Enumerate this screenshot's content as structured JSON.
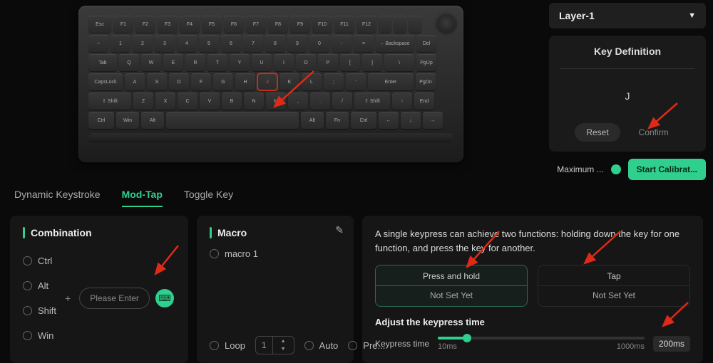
{
  "layer": {
    "label": "Layer-1"
  },
  "keydef": {
    "title": "Key Definition",
    "key": "J",
    "reset": "Reset",
    "confirm": "Confirm"
  },
  "calib": {
    "max_label": "Maximum ...",
    "start": "Start Calibrat..."
  },
  "tabs": {
    "dynamic": "Dynamic Keystroke",
    "modtap": "Mod-Tap",
    "toggle": "Toggle Key"
  },
  "combination": {
    "title": "Combination",
    "mods": [
      "Ctrl",
      "Alt",
      "Shift",
      "Win"
    ],
    "placeholder": "Please Enter"
  },
  "macro": {
    "title": "Macro",
    "item": "macro 1",
    "loop": "Loop",
    "loop_count": "1",
    "auto": "Auto",
    "pre": "Pre..."
  },
  "desc": {
    "text": "A single keypress can achieve two functions: holding down the key for one function, and press the key for another.",
    "hold_title": "Press and hold",
    "hold_value": "Not Set Yet",
    "tap_title": "Tap",
    "tap_value": "Not Set Yet",
    "adjust_title": "Adjust the keypress time",
    "keypress_label": "Keypress time",
    "min": "10ms",
    "max": "1000ms",
    "value": "200ms"
  },
  "keyboard": {
    "row_fn": [
      "Esc",
      "F1",
      "F2",
      "F3",
      "F4",
      "F5",
      "F6",
      "F7",
      "F8",
      "F9",
      "F10",
      "F11",
      "F12",
      "",
      "",
      ""
    ],
    "row_num": [
      "~",
      "1",
      "2",
      "3",
      "4",
      "5",
      "6",
      "7",
      "8",
      "9",
      "0",
      "-",
      "=",
      "←Backspace",
      "Del"
    ],
    "row_q": [
      "Tab",
      "Q",
      "W",
      "E",
      "R",
      "T",
      "Y",
      "U",
      "I",
      "O",
      "P",
      "[",
      "]",
      "\\",
      "PgUp"
    ],
    "row_a": [
      "CapsLock",
      "A",
      "S",
      "D",
      "F",
      "G",
      "H",
      "J",
      "K",
      "L",
      ";",
      "'",
      "Enter",
      "PgDn"
    ],
    "row_z": [
      "⇧ Shift",
      "Z",
      "X",
      "C",
      "V",
      "B",
      "N",
      "M",
      ",",
      ".",
      "/",
      "⇧ Shift",
      "↑",
      "End"
    ],
    "row_sp": [
      "Ctrl",
      "Win",
      "Alt",
      "",
      "Alt",
      "Fn",
      "Ctrl",
      "←",
      "↓",
      "→"
    ],
    "selected": "J"
  }
}
